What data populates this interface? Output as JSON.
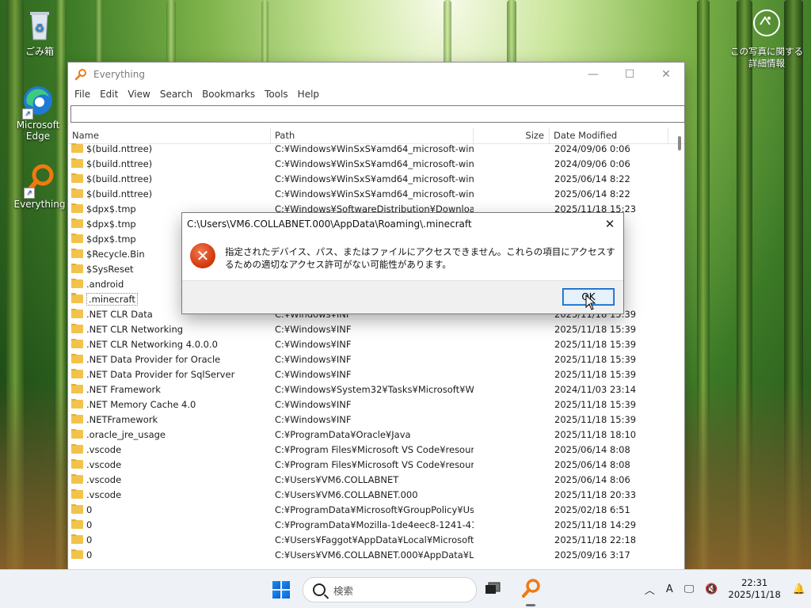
{
  "desktop": {
    "icons": [
      {
        "label": "ごみ箱"
      },
      {
        "label": "Microsoft Edge"
      },
      {
        "label": "Everything"
      }
    ],
    "photo_info": "この写真に関する詳細情報"
  },
  "window": {
    "title": "Everything",
    "menu": [
      "File",
      "Edit",
      "View",
      "Search",
      "Bookmarks",
      "Tools",
      "Help"
    ],
    "search_value": "",
    "columns": {
      "name": "Name",
      "path": "Path",
      "size": "Size",
      "date": "Date Modified"
    },
    "rows": [
      {
        "name": "$(build.nttree)",
        "path": "C:¥Windows¥WinSxS¥amd64_microsoft-wind...",
        "date": "2024/09/06 0:06"
      },
      {
        "name": "$(build.nttree)",
        "path": "C:¥Windows¥WinSxS¥amd64_microsoft-wind...",
        "date": "2024/09/06 0:06"
      },
      {
        "name": "$(build.nttree)",
        "path": "C:¥Windows¥WinSxS¥amd64_microsoft-wind...",
        "date": "2025/06/14 8:22"
      },
      {
        "name": "$(build.nttree)",
        "path": "C:¥Windows¥WinSxS¥amd64_microsoft-wind...",
        "date": "2025/06/14 8:22"
      },
      {
        "name": "$dpx$.tmp",
        "path": "C:¥Windows¥SoftwareDistribution¥Download...",
        "date": "2025/11/18 15:23"
      },
      {
        "name": "$dpx$.tmp",
        "path": "",
        "date": ""
      },
      {
        "name": "$dpx$.tmp",
        "path": "",
        "date": ""
      },
      {
        "name": "$Recycle.Bin",
        "path": "",
        "date": ""
      },
      {
        "name": "$SysReset",
        "path": "",
        "date": ""
      },
      {
        "name": ".android",
        "path": "",
        "date": ""
      },
      {
        "name": ".minecraft",
        "path": "",
        "date": "",
        "selected": true
      },
      {
        "name": ".NET CLR Data",
        "path": "C:¥Windows¥INF",
        "date": "2025/11/18 15:39"
      },
      {
        "name": ".NET CLR Networking",
        "path": "C:¥Windows¥INF",
        "date": "2025/11/18 15:39"
      },
      {
        "name": ".NET CLR Networking 4.0.0.0",
        "path": "C:¥Windows¥INF",
        "date": "2025/11/18 15:39"
      },
      {
        "name": ".NET Data Provider for Oracle",
        "path": "C:¥Windows¥INF",
        "date": "2025/11/18 15:39"
      },
      {
        "name": ".NET Data Provider for SqlServer",
        "path": "C:¥Windows¥INF",
        "date": "2025/11/18 15:39"
      },
      {
        "name": ".NET Framework",
        "path": "C:¥Windows¥System32¥Tasks¥Microsoft¥Win...",
        "date": "2024/11/03 23:14"
      },
      {
        "name": ".NET Memory Cache 4.0",
        "path": "C:¥Windows¥INF",
        "date": "2025/11/18 15:39"
      },
      {
        "name": ".NETFramework",
        "path": "C:¥Windows¥INF",
        "date": "2025/11/18 15:39"
      },
      {
        "name": ".oracle_jre_usage",
        "path": "C:¥ProgramData¥Oracle¥Java",
        "date": "2025/11/18 18:10"
      },
      {
        "name": ".vscode",
        "path": "C:¥Program Files¥Microsoft VS Code¥resourc...",
        "date": "2025/06/14 8:08"
      },
      {
        "name": ".vscode",
        "path": "C:¥Program Files¥Microsoft VS Code¥resourc...",
        "date": "2025/06/14 8:08"
      },
      {
        "name": ".vscode",
        "path": "C:¥Users¥VM6.COLLABNET",
        "date": "2025/06/14 8:06"
      },
      {
        "name": ".vscode",
        "path": "C:¥Users¥VM6.COLLABNET.000",
        "date": "2025/11/18 20:33"
      },
      {
        "name": "0",
        "path": "C:¥ProgramData¥Microsoft¥GroupPolicy¥Use...",
        "date": "2025/02/18 6:51"
      },
      {
        "name": "0",
        "path": "C:¥ProgramData¥Mozilla-1de4eec8-1241-417...",
        "date": "2025/11/18 14:29"
      },
      {
        "name": "0",
        "path": "C:¥Users¥Faggot¥AppData¥Local¥Microsoft¥...",
        "date": "2025/11/18 22:18"
      },
      {
        "name": "0",
        "path": "C:¥Users¥VM6.COLLABNET.000¥AppData¥Loc...",
        "date": "2025/09/16 3:17"
      }
    ]
  },
  "dialog": {
    "title": "C:\\Users\\VM6.COLLABNET.000\\AppData\\Roaming\\.minecraft",
    "message": "指定されたデバイス、パス、またはファイルにアクセスできません。これらの項目にアクセスするための適切なアクセス許可がない可能性があります。",
    "ok_label": "OK",
    "icon": "error-icon"
  },
  "taskbar": {
    "search_placeholder": "検索",
    "ime": "A",
    "time": "22:31",
    "date": "2025/11/18"
  }
}
